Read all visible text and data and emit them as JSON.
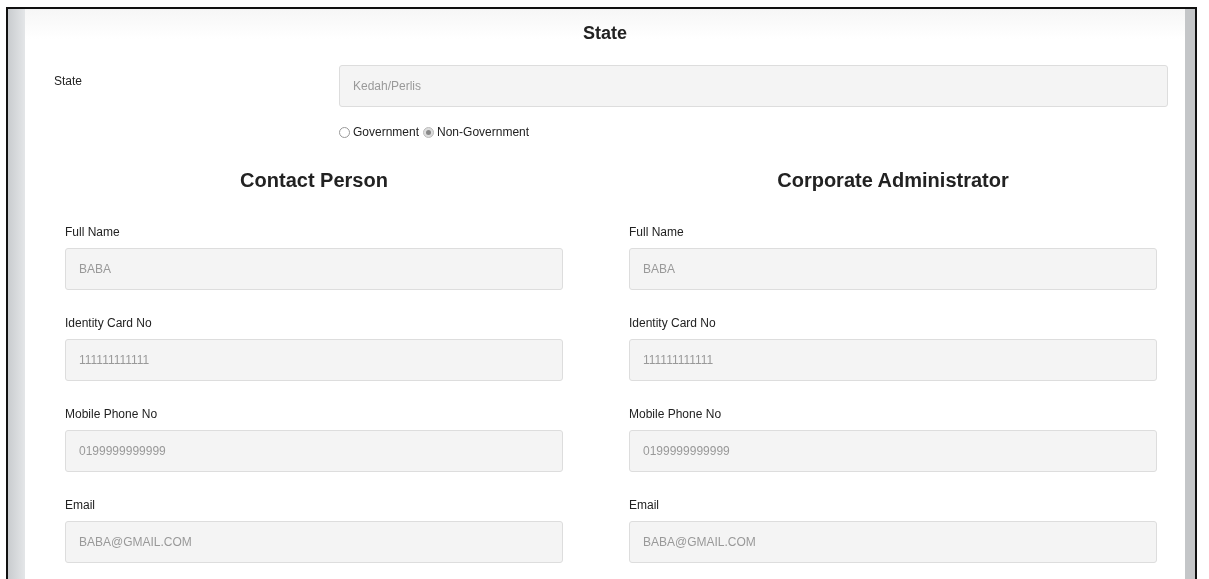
{
  "title": "State",
  "state_field": {
    "label": "State",
    "value": "Kedah/Perlis"
  },
  "sector_options": [
    {
      "label": "Government",
      "selected": false
    },
    {
      "label": "Non-Government",
      "selected": true
    }
  ],
  "sections": [
    {
      "heading": "Contact Person",
      "fields": [
        {
          "label": "Full Name",
          "value": "BABA"
        },
        {
          "label": "Identity Card No",
          "value": "111111111111"
        },
        {
          "label": "Mobile Phone No",
          "value": "0199999999999"
        },
        {
          "label": "Email",
          "value": "BABA@GMAIL.COM"
        }
      ]
    },
    {
      "heading": "Corporate Administrator",
      "fields": [
        {
          "label": "Full Name",
          "value": "BABA"
        },
        {
          "label": "Identity Card No",
          "value": "111111111111"
        },
        {
          "label": "Mobile Phone No",
          "value": "0199999999999"
        },
        {
          "label": "Email",
          "value": "BABA@GMAIL.COM"
        }
      ]
    }
  ]
}
